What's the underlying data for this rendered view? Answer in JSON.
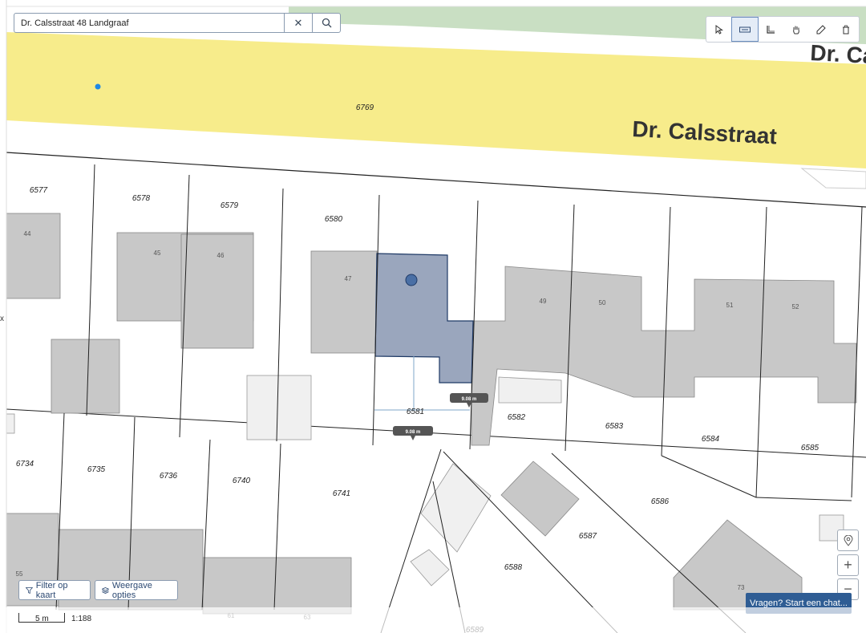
{
  "search": {
    "value": "Dr. Calsstraat 48 Landgraaf",
    "clear_icon": "close-icon",
    "search_icon": "search-icon"
  },
  "toolbar": {
    "tools": [
      "pointer-icon",
      "measure-distance-icon",
      "measure-area-icon",
      "pan-hand-icon",
      "draw-icon",
      "delete-icon"
    ],
    "active_tool": "measure-distance-icon"
  },
  "map": {
    "streets": [
      "Dr. Calsstraat",
      "Dr. Ca"
    ],
    "road_parcel": "6769",
    "parcels": [
      "6577",
      "6578",
      "6579",
      "6580",
      "6581",
      "6582",
      "6583",
      "6584",
      "6585",
      "6586",
      "6587",
      "6588",
      "6589",
      "6734",
      "6735",
      "6736",
      "6740",
      "6741"
    ],
    "house_numbers": [
      "44",
      "45",
      "46",
      "47",
      "49",
      "50",
      "51",
      "52",
      "55",
      "61",
      "63",
      "73"
    ],
    "measurements": [
      "9.08 m",
      "9.08 m"
    ],
    "colors": {
      "road": "#f7ec8b",
      "building": "#c8c8c8",
      "selected": "#9aa6bd",
      "green": "#c9dfc3",
      "measure_line": "#7fa7c9"
    }
  },
  "controls": {
    "filter_label": "Filter op kaart",
    "display_label": "Weergave opties",
    "zoom_in": "+",
    "zoom_out": "−",
    "chat_label": "Vragen? Start een chat...",
    "scale_text": "5 m",
    "scale_ratio": "1:188",
    "edge_mark": "x"
  }
}
